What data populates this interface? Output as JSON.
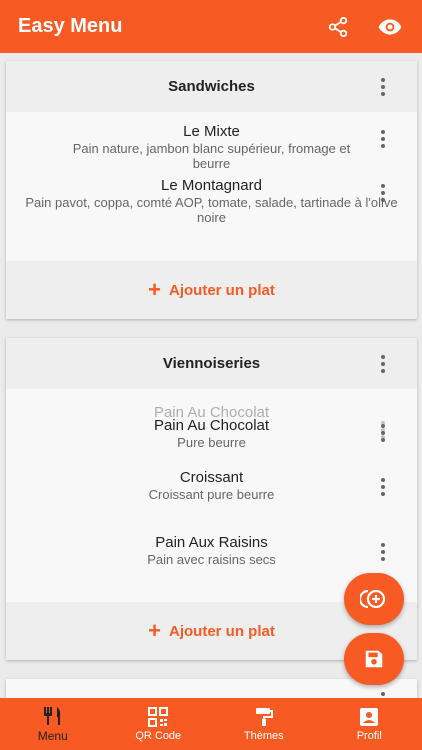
{
  "appbar": {
    "title": "Easy Menu"
  },
  "sections": [
    {
      "title": "Sandwiches",
      "items": [
        {
          "name": "Le Mixte",
          "description": "Pain nature, jambon blanc supérieur, fromage et beurre"
        },
        {
          "name": "Le Montagnard",
          "description": "Pain pavot, coppa, comté AOP, tomate, salade, tartinade à l'olive noire"
        }
      ],
      "add_label": "Ajouter un plat"
    },
    {
      "title": "Viennoiseries",
      "ghost_item": {
        "name": "Pain Au Chocolat"
      },
      "items": [
        {
          "name": "Pain Au Chocolat",
          "description": "Pure beurre"
        },
        {
          "name": "Croissant",
          "description": "Croissant pure beurre"
        },
        {
          "name": "Pain Aux Raisins",
          "description": "Pain avec raisins secs"
        }
      ],
      "add_label": "Ajouter un plat"
    }
  ],
  "bottom_nav": [
    {
      "label": "Menu",
      "icon": "utensils-icon",
      "active": true
    },
    {
      "label": "QR Code",
      "icon": "qr-code-icon",
      "active": false
    },
    {
      "label": "Thèmes",
      "icon": "paint-roller-icon",
      "active": false
    },
    {
      "label": "Profil",
      "icon": "profile-icon",
      "active": false
    }
  ],
  "colors": {
    "primary": "#f85a24",
    "background": "#ebebeb",
    "card": "#f8f8f8"
  }
}
